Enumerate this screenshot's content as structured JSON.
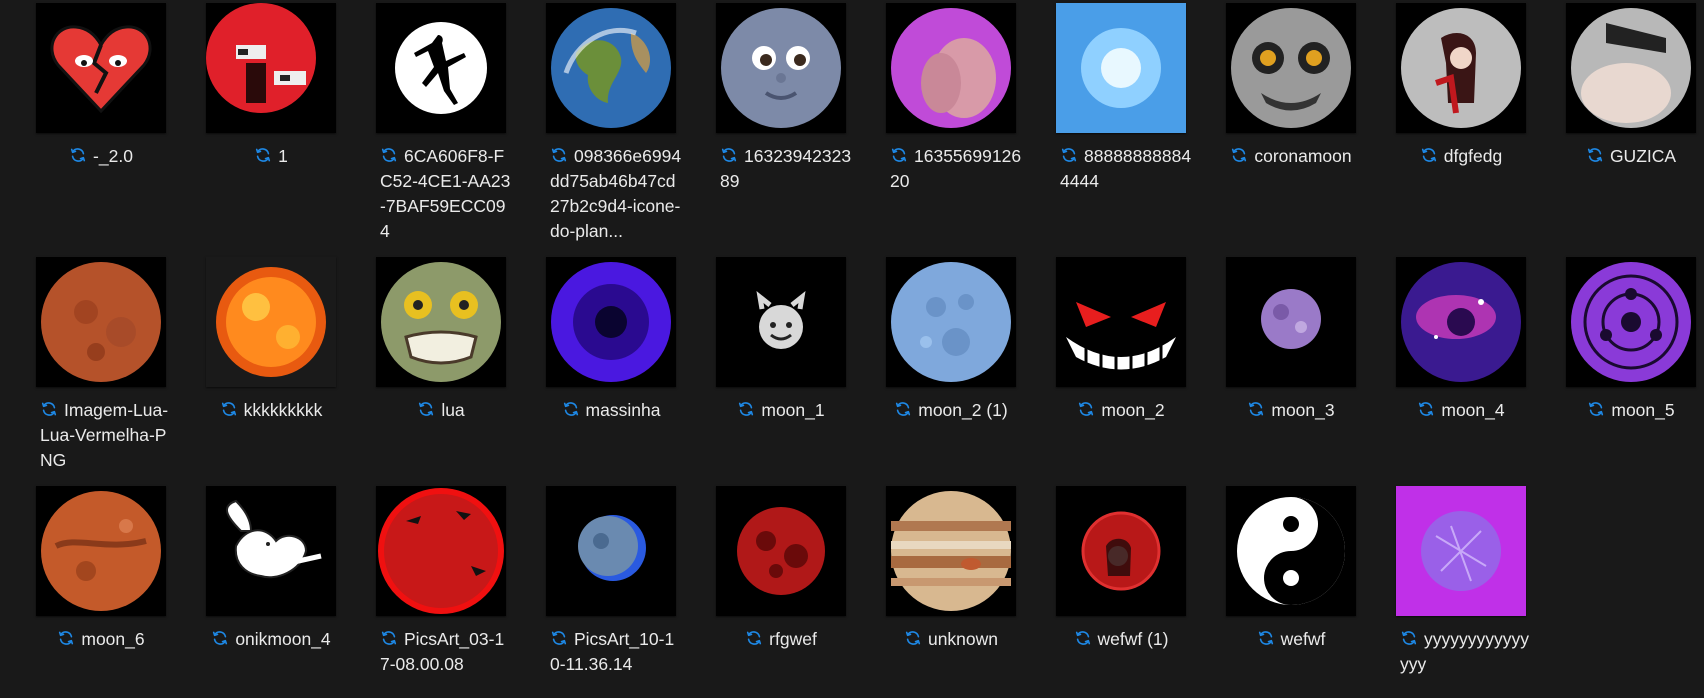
{
  "sync_icon": "sync-icon",
  "accent": "#1e88e5",
  "files": [
    {
      "name": "-_2.0",
      "thumb": "broken-heart"
    },
    {
      "name": "1",
      "thumb": "red-disc-pixel"
    },
    {
      "name": "6CA606F8-FC52-4CE1-AA23-7BAF59ECC094",
      "thumb": "jumpman-logo"
    },
    {
      "name": "098366e6994dd75ab46b47cd27b2c9d4-icone-do-plan...",
      "thumb": "earth"
    },
    {
      "name": "1632394232389",
      "thumb": "moon-face"
    },
    {
      "name": "1635569912620",
      "thumb": "purple-disc"
    },
    {
      "name": "888888888844444",
      "thumb": "blue-energy"
    },
    {
      "name": "coronamoon",
      "thumb": "grey-moon-face"
    },
    {
      "name": "dfgfedg",
      "thumb": "moon-figure"
    },
    {
      "name": "GUZICA",
      "thumb": "grey-disc"
    },
    {
      "name": "Imagem-Lua-Lua-Vermelha-PNG",
      "thumb": "red-moon"
    },
    {
      "name": "kkkkkkkkk",
      "thumb": "sun"
    },
    {
      "name": "lua",
      "thumb": "green-moon-face"
    },
    {
      "name": "massinha",
      "thumb": "blue-vortex"
    },
    {
      "name": "moon_1",
      "thumb": "devil-emoji"
    },
    {
      "name": "moon_2 (1)",
      "thumb": "blue-moon"
    },
    {
      "name": "moon_2",
      "thumb": "red-eyes-grin"
    },
    {
      "name": "moon_3",
      "thumb": "small-purple-moon"
    },
    {
      "name": "moon_4",
      "thumb": "nebula"
    },
    {
      "name": "moon_5",
      "thumb": "purple-sharingan"
    },
    {
      "name": "moon_6",
      "thumb": "mars"
    },
    {
      "name": "onikmoon_4",
      "thumb": "cupid"
    },
    {
      "name": "PicsArt_03-17-08.00.08",
      "thumb": "red-moon-bats"
    },
    {
      "name": "PicsArt_10-10-11.36.14",
      "thumb": "small-blue-moon"
    },
    {
      "name": "rfgwef",
      "thumb": "dark-red-moon"
    },
    {
      "name": "unknown",
      "thumb": "jupiter"
    },
    {
      "name": "wefwf (1)",
      "thumb": "red-moon-girl"
    },
    {
      "name": "wefwf",
      "thumb": "yin-yang"
    },
    {
      "name": "yyyyyyyyyyyyyyy",
      "thumb": "magenta-square"
    }
  ]
}
